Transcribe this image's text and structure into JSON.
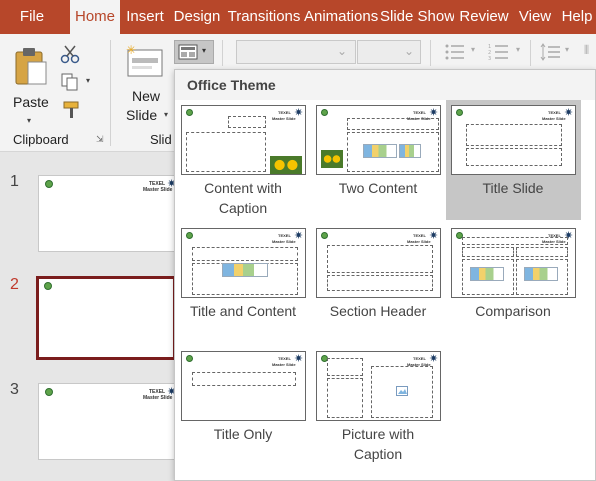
{
  "tabs": [
    "File",
    "Home",
    "Insert",
    "Design",
    "Transitions",
    "Animations",
    "Slide Show",
    "Review",
    "View",
    "Help"
  ],
  "active_tab": "Home",
  "ribbon": {
    "paste_label": "Paste",
    "clipboard_group": "Clipboard",
    "new_slide_line1": "New",
    "new_slide_line2": "Slide",
    "slides_group_partial": "Slid"
  },
  "slides": [
    {
      "number": "1",
      "selected": false,
      "brand": "TEXEL",
      "caption": "Master Slide"
    },
    {
      "number": "2",
      "selected": true
    },
    {
      "number": "3",
      "selected": false,
      "brand": "TEXEL",
      "caption": "Master Slide"
    }
  ],
  "layout_menu": {
    "title": "Office Theme",
    "items": [
      {
        "id": "content-with-caption",
        "lines": [
          "Content with",
          "Caption"
        ]
      },
      {
        "id": "two-content",
        "lines": [
          "Two Content"
        ]
      },
      {
        "id": "title-slide",
        "lines": [
          "Title Slide"
        ],
        "highlighted": true
      },
      {
        "id": "title-and-content",
        "lines": [
          "Title and Content"
        ]
      },
      {
        "id": "section-header",
        "lines": [
          "Section Header"
        ]
      },
      {
        "id": "comparison",
        "lines": [
          "Comparison"
        ]
      },
      {
        "id": "title-only",
        "lines": [
          "Title Only"
        ]
      },
      {
        "id": "picture-with-caption",
        "lines": [
          "Picture with",
          "Caption"
        ]
      }
    ],
    "thumb_brand": "TEXEL",
    "thumb_caption": "Master Slide"
  },
  "colors": {
    "accent": "#b7472a",
    "selected_slide": "#7a1d1d",
    "highlight": "#c6c6c6"
  }
}
